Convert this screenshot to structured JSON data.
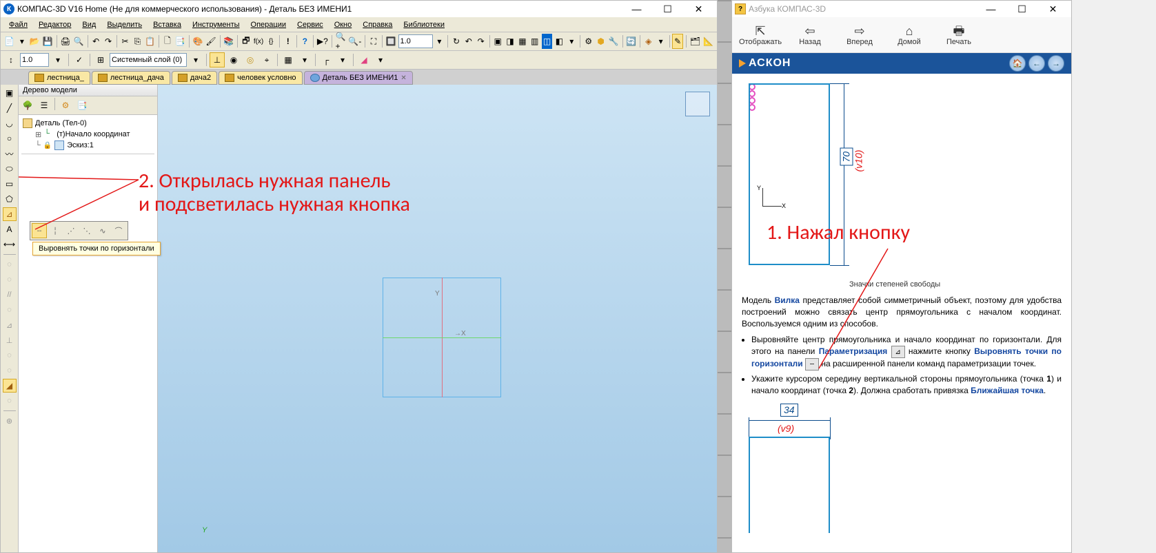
{
  "main": {
    "title": "КОМПАС-3D V16 Home  (Не для коммерческого использования) - Деталь БЕЗ ИМЕНИ1",
    "menu": [
      "Файл",
      "Редактор",
      "Вид",
      "Выделить",
      "Вставка",
      "Инструменты",
      "Операции",
      "Сервис",
      "Окно",
      "Справка",
      "Библиотеки"
    ],
    "scale_values": [
      "1.0",
      "1.0"
    ],
    "layer_combo": "Системный слой (0)",
    "tabs": [
      {
        "label": "лестница_",
        "kind": "yellow"
      },
      {
        "label": "лестница_дача",
        "kind": "yellow"
      },
      {
        "label": "дача2",
        "kind": "yellow"
      },
      {
        "label": "человек условно",
        "kind": "yellow"
      },
      {
        "label": "Деталь БЕЗ ИМЕНИ1",
        "kind": "active",
        "closable": true
      }
    ],
    "tree_title": "Дерево модели",
    "tree": {
      "root": "Деталь (Тел-0)",
      "origin": "(т)Начало координат",
      "sketch": "Эскиз:1"
    },
    "popup_tooltip": "Выровнять точки по горизонтали",
    "axis_labels": {
      "x": "→X",
      "y": "Y"
    },
    "bottom_y": "Y",
    "annotation": {
      "line1": "2. Открылась нужная панель",
      "line2": "и подсветилась нужная кнопка"
    }
  },
  "help": {
    "window_title": "Азбука КОМПАС-3D",
    "nav": [
      {
        "glyph": "⇱",
        "label": "Отображать"
      },
      {
        "glyph": "⇦",
        "label": "Назад"
      },
      {
        "glyph": "⇨",
        "label": "Вперед"
      },
      {
        "glyph": "⌂",
        "label": "Домой"
      },
      {
        "glyph": "🖶",
        "label": "Печать"
      }
    ],
    "brand": "АСКОН",
    "drawing1": {
      "dim": "70",
      "dim_red": "(v10)",
      "caption": "Значки степеней свободы",
      "orig_x": "X",
      "orig_y": "Y"
    },
    "para": {
      "pre": "Модель ",
      "link": "Вилка",
      "post": " представляет собой симметричный объект, поэтому для удобства построений можно связать центр прямоугольника с началом координат. Воспользуемся одним из способов."
    },
    "bullets": {
      "b1": {
        "pre": "Выровняйте центр прямоугольника и начало координат по горизонтали. Для этого на панели ",
        "link1": "Параметризация",
        "mid": " нажмите кнопку ",
        "link2": "Выровнять точки по горизонтали",
        "post": " на расширенной панели команд параметризации точек."
      },
      "b2": {
        "pre": "Укажите курсором середину вертикальной стороны прямоугольника (точка ",
        "p1": "1",
        "mid": ") и начало координат (точка ",
        "p2": "2",
        "post": "). Должна сработать привязка ",
        "link": "Ближайшая точка",
        "end": "."
      }
    },
    "drawing2": {
      "dim": "34",
      "dim_red": "(v9)"
    },
    "annotation": "1. Нажал кнопку"
  }
}
